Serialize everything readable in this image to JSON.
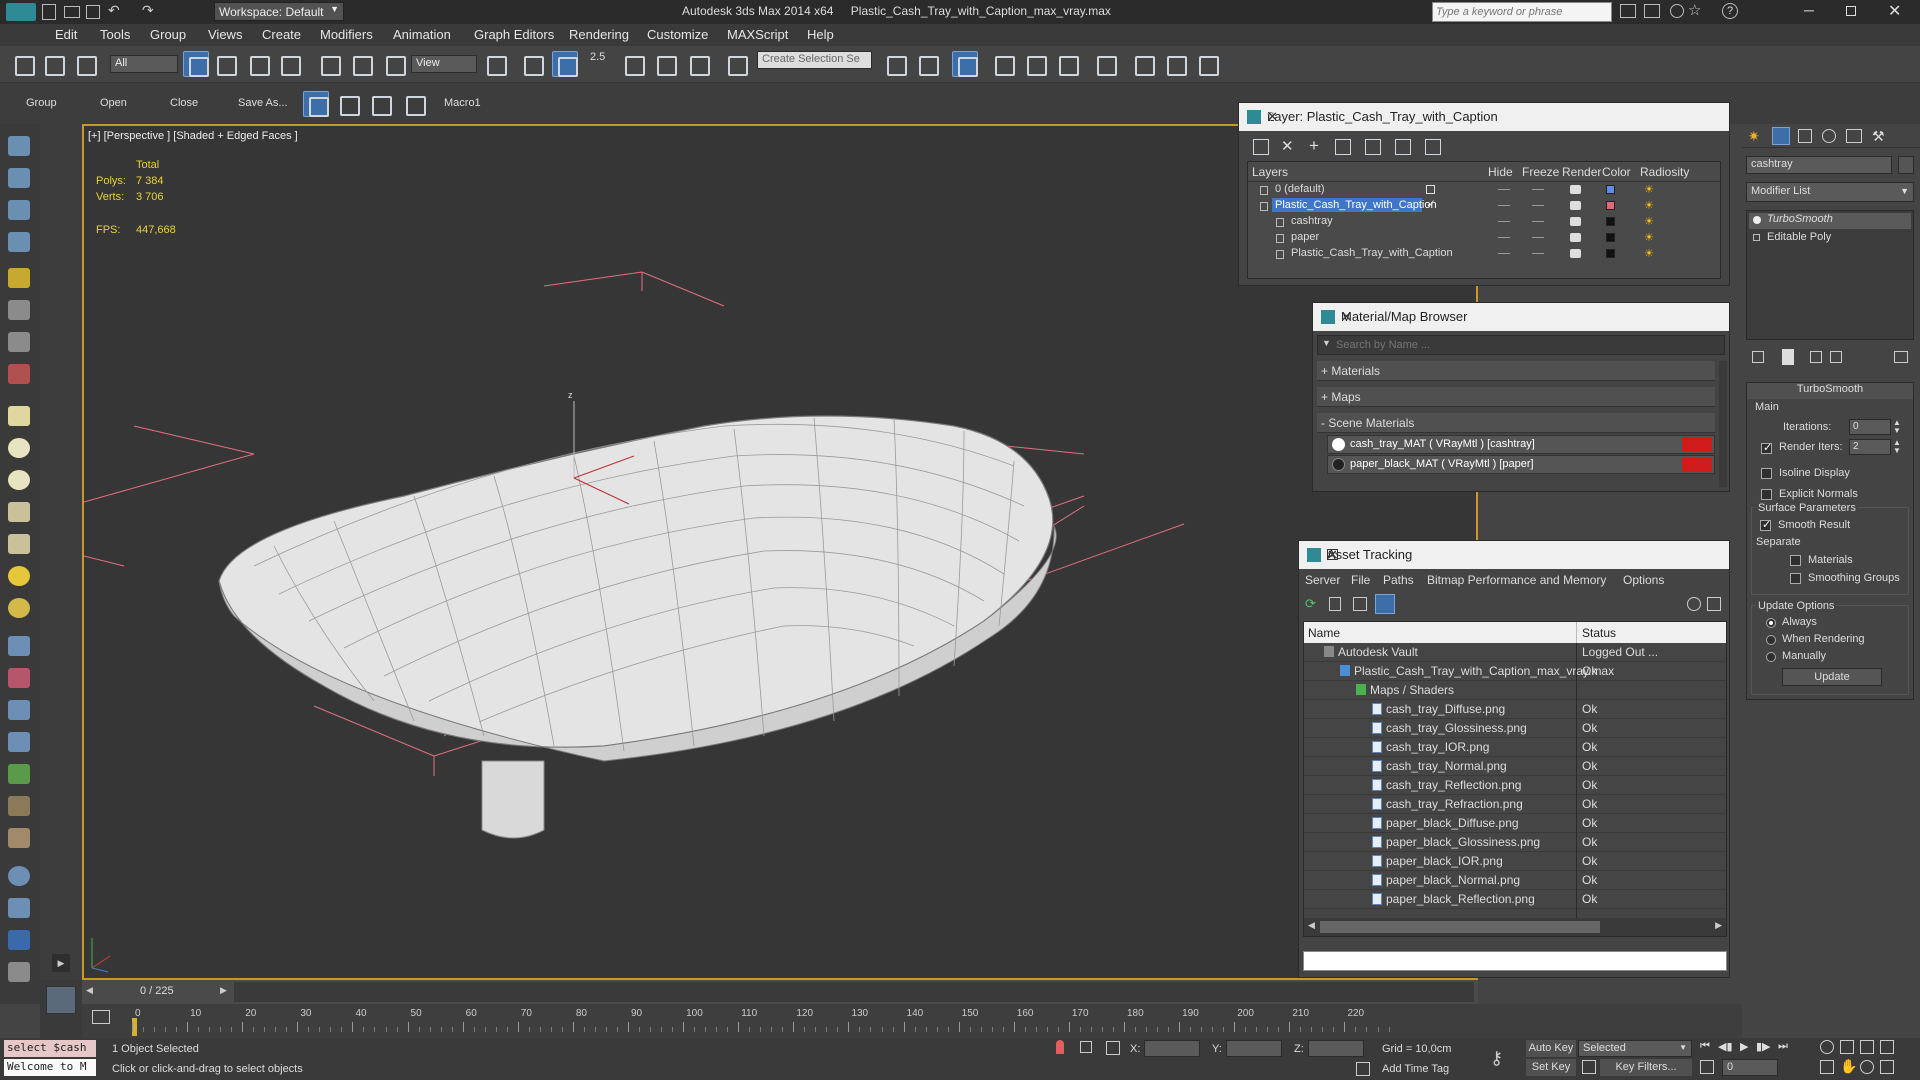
{
  "titlebar": {
    "workspace": "Workspace: Default",
    "app_title": "Autodesk 3ds Max  2014 x64",
    "file_title": "Plastic_Cash_Tray_with_Caption_max_vray.max",
    "search_placeholder": "Type a keyword or phrase"
  },
  "menu": [
    "Edit",
    "Tools",
    "Group",
    "Views",
    "Create",
    "Modifiers",
    "Animation",
    "Graph Editors",
    "Rendering",
    "Customize",
    "MAXScript",
    "Help"
  ],
  "toolbar": {
    "filter": "All",
    "ref_coord": "View",
    "snap_angle": "2.5",
    "named_selection": "Create Selection Se"
  },
  "toolbar2": {
    "group": "Group",
    "open": "Open",
    "close": "Close",
    "save_as": "Save As...",
    "macro": "Macro1"
  },
  "viewport": {
    "label": "[+] [Perspective ] [Shaded + Edged Faces ]",
    "stats_total": "Total",
    "polys_label": "Polys:",
    "polys_value": "7 384",
    "verts_label": "Verts:",
    "verts_value": "3 706",
    "fps_label": "FPS:",
    "fps_value": "447,668",
    "axis_x": "x",
    "axis_y": "y",
    "axis_z": "z"
  },
  "layer_win": {
    "title": "Layer: Plastic_Cash_Tray_with_Caption",
    "help": "?",
    "columns": [
      "Layers",
      "Hide",
      "Freeze",
      "Render",
      "Color",
      "Radiosity"
    ],
    "rows": [
      {
        "name": "0 (default)",
        "indent": 0,
        "color": "#5b8ee0"
      },
      {
        "name": "Plastic_Cash_Tray_with_Caption",
        "indent": 0,
        "selected": true,
        "color": "#e06a7a"
      },
      {
        "name": "cashtray",
        "indent": 1,
        "color": "#111111"
      },
      {
        "name": "paper",
        "indent": 1,
        "color": "#111111"
      },
      {
        "name": "Plastic_Cash_Tray_with_Caption",
        "indent": 1,
        "color": "#111111"
      }
    ]
  },
  "mat_win": {
    "title": "Material/Map Browser",
    "search_placeholder": "Search by Name ...",
    "sections": [
      "+ Materials",
      "+ Maps",
      "- Scene Materials"
    ],
    "materials": [
      "cash_tray_MAT  ( VRayMtl )  [cashtray]",
      "paper_black_MAT  ( VRayMtl )  [paper]"
    ]
  },
  "asset_win": {
    "title": "Asset Tracking",
    "menu": [
      "Server",
      "File",
      "Paths",
      "Bitmap Performance and Memory",
      "Options"
    ],
    "col_name": "Name",
    "col_status": "Status",
    "rows": [
      {
        "name": "Autodesk Vault",
        "status": "Logged Out ...",
        "indent": 1
      },
      {
        "name": "Plastic_Cash_Tray_with_Caption_max_vray.max",
        "status": "Ok",
        "indent": 2
      },
      {
        "name": "Maps / Shaders",
        "status": "",
        "indent": 3
      },
      {
        "name": "cash_tray_Diffuse.png",
        "status": "Ok",
        "indent": 4
      },
      {
        "name": "cash_tray_Glossiness.png",
        "status": "Ok",
        "indent": 4
      },
      {
        "name": "cash_tray_IOR.png",
        "status": "Ok",
        "indent": 4
      },
      {
        "name": "cash_tray_Normal.png",
        "status": "Ok",
        "indent": 4
      },
      {
        "name": "cash_tray_Reflection.png",
        "status": "Ok",
        "indent": 4
      },
      {
        "name": "cash_tray_Refraction.png",
        "status": "Ok",
        "indent": 4
      },
      {
        "name": "paper_black_Diffuse.png",
        "status": "Ok",
        "indent": 4
      },
      {
        "name": "paper_black_Glossiness.png",
        "status": "Ok",
        "indent": 4
      },
      {
        "name": "paper_black_IOR.png",
        "status": "Ok",
        "indent": 4
      },
      {
        "name": "paper_black_Normal.png",
        "status": "Ok",
        "indent": 4
      },
      {
        "name": "paper_black_Reflection.png",
        "status": "Ok",
        "indent": 4
      }
    ]
  },
  "cmd": {
    "object_name": "cashtray",
    "modifier_list": "Modifier List",
    "stack": [
      "TurboSmooth",
      "Editable Poly"
    ],
    "rollout_title": "TurboSmooth",
    "main": "Main",
    "iterations_label": "Iterations:",
    "iterations_value": "0",
    "render_iters_label": "Render Iters:",
    "render_iters_value": "2",
    "isoline": "Isoline Display",
    "explicit_normals": "Explicit Normals",
    "surface_params": "Surface Parameters",
    "smooth_result": "Smooth Result",
    "separate": "Separate",
    "materials": "Materials",
    "smoothing_groups": "Smoothing Groups",
    "update_options": "Update Options",
    "always": "Always",
    "when_rendering": "When Rendering",
    "manually": "Manually",
    "update_btn": "Update"
  },
  "timeline": {
    "frame": "0 / 225"
  },
  "ruler_ticks": [
    "0",
    "10",
    "20",
    "30",
    "40",
    "50",
    "60",
    "70",
    "80",
    "90",
    "100",
    "110",
    "120",
    "130",
    "140",
    "150",
    "160",
    "170",
    "180",
    "190",
    "200",
    "210",
    "220"
  ],
  "status": {
    "script1": "select $cash",
    "script2": "Welcome to M",
    "selected": "1 Object Selected",
    "prompt": "Click or click-and-drag to select objects",
    "x": "X:",
    "y": "Y:",
    "z": "Z:",
    "grid": "Grid = 10,0cm",
    "add_time_tag": "Add Time Tag",
    "auto_key": "Auto Key",
    "set_key": "Set Key",
    "selected_dd": "Selected",
    "key_filters": "Key Filters...",
    "frame_field": "0"
  }
}
